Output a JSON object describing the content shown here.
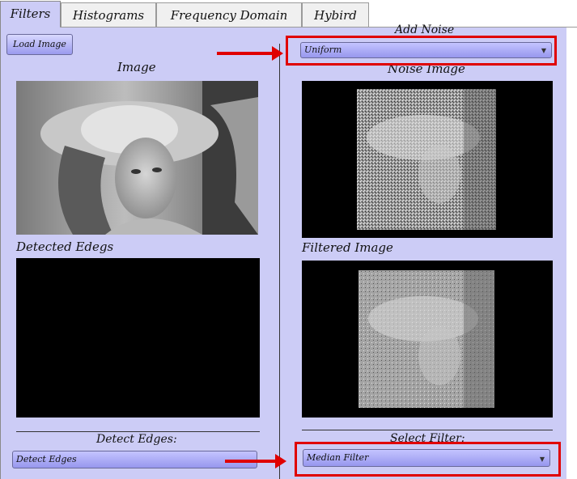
{
  "tabs": [
    {
      "label": "Filters",
      "active": true
    },
    {
      "label": "Histograms",
      "active": false
    },
    {
      "label": "Frequency Domain",
      "active": false
    },
    {
      "label": "Hybird",
      "active": false
    }
  ],
  "left": {
    "load_button": "Load Image",
    "image_title": "Image",
    "edges_title": "Detected Edegs",
    "detect_label": "Detect Edges:",
    "detect_combo_value": "Detect Edges"
  },
  "right": {
    "add_noise_label": "Add Noise",
    "noise_combo_value": "Uniform",
    "noise_image_title": "Noise Image",
    "filtered_title": "Filtered Image",
    "select_filter_label": "Select Filter:",
    "filter_combo_value": "Median Filter"
  },
  "colors": {
    "panel_bg": "#ccccf6",
    "highlight": "#e00000"
  }
}
